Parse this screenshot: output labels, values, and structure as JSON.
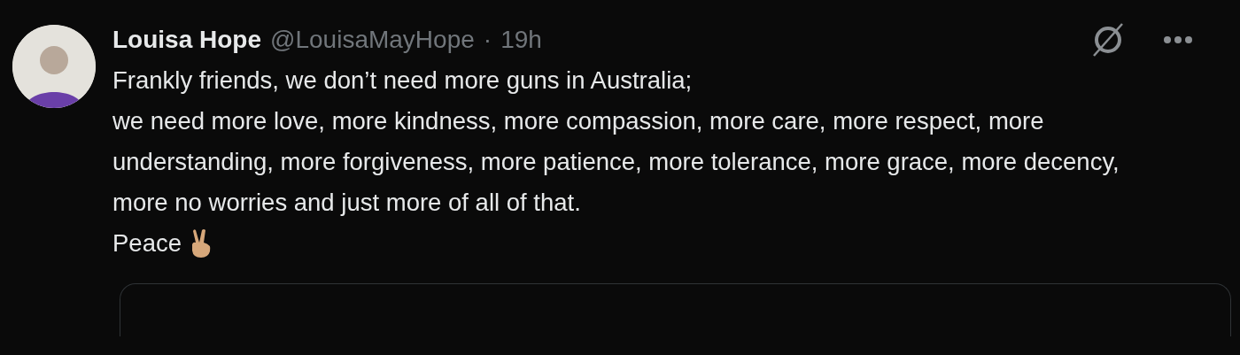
{
  "post": {
    "author_name": "Louisa Hope",
    "handle": "@LouisaMayHope",
    "separator": "·",
    "time": "19h",
    "paragraphs": [
      "Frankly friends, we don’t need more guns in Australia;",
      "we need more love, more kindness, more compassion, more care, more respect, more understanding, more forgiveness, more patience, more tolerance, more grace, more decency, more no worries and just more of all of that.",
      "Peace"
    ]
  }
}
